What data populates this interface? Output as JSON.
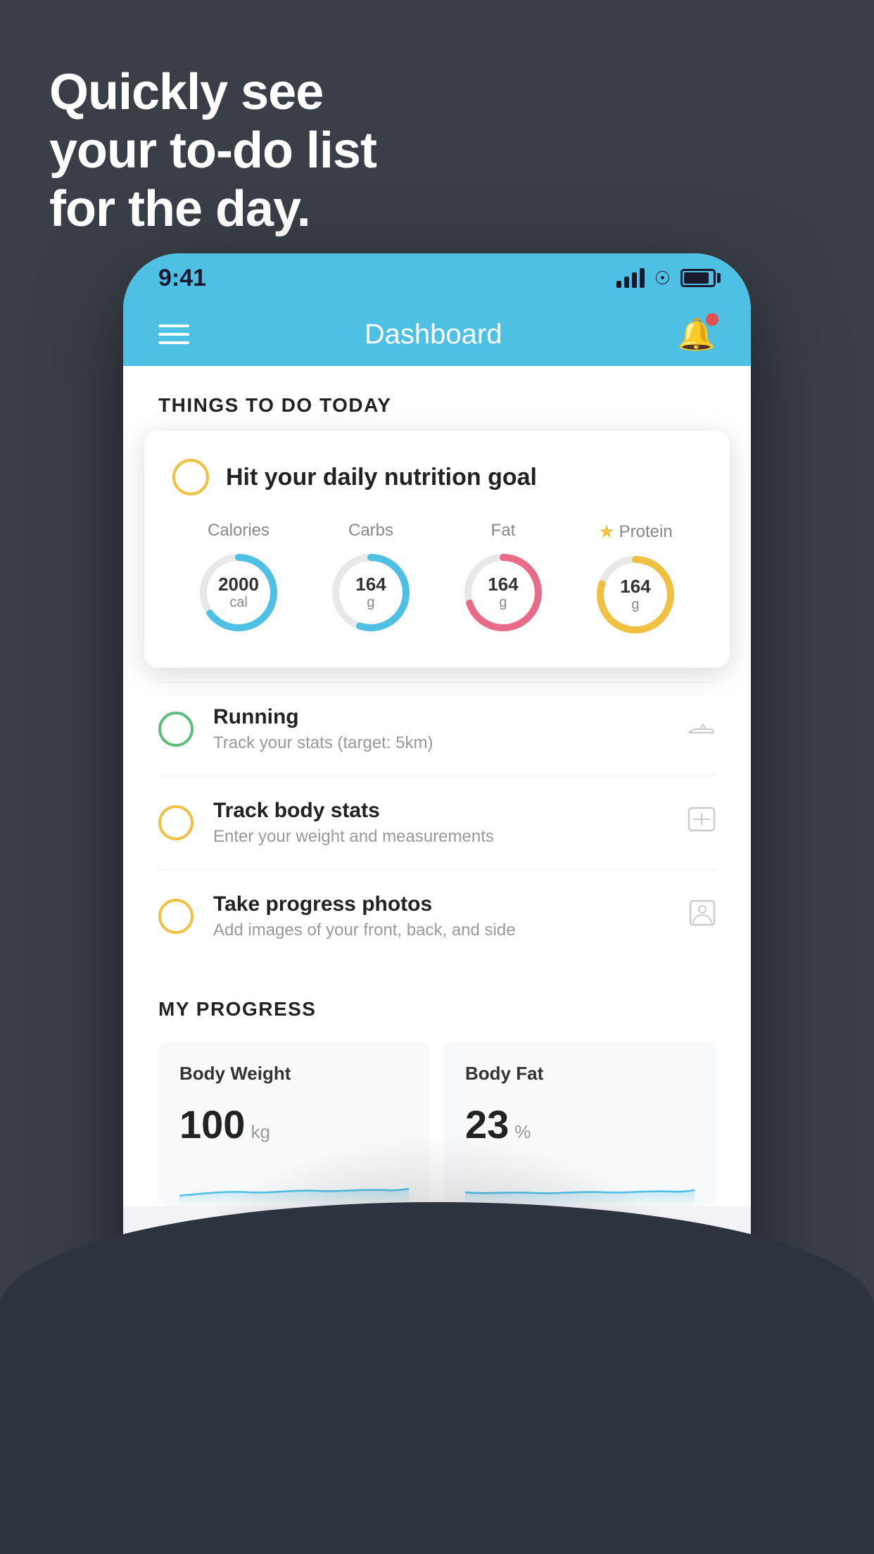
{
  "hero": {
    "line1": "Quickly see",
    "line2": "your to-do list",
    "line3": "for the day."
  },
  "statusBar": {
    "time": "9:41"
  },
  "navBar": {
    "title": "Dashboard"
  },
  "thingsToDoSection": {
    "title": "THINGS TO DO TODAY"
  },
  "nutritionCard": {
    "checkboxColor": "yellow",
    "title": "Hit your daily nutrition goal",
    "nutrients": [
      {
        "label": "Calories",
        "value": "2000",
        "unit": "cal",
        "color": "blue",
        "percent": 65,
        "starred": false
      },
      {
        "label": "Carbs",
        "value": "164",
        "unit": "g",
        "color": "blue",
        "percent": 55,
        "starred": false
      },
      {
        "label": "Fat",
        "value": "164",
        "unit": "g",
        "color": "pink",
        "percent": 70,
        "starred": false
      },
      {
        "label": "Protein",
        "value": "164",
        "unit": "g",
        "color": "yellow",
        "percent": 80,
        "starred": true
      }
    ]
  },
  "todoItems": [
    {
      "id": "running",
      "checkboxColor": "green",
      "main": "Running",
      "sub": "Track your stats (target: 5km)",
      "icon": "shoe"
    },
    {
      "id": "track-body",
      "checkboxColor": "yellow",
      "main": "Track body stats",
      "sub": "Enter your weight and measurements",
      "icon": "scale"
    },
    {
      "id": "progress-photos",
      "checkboxColor": "yellow",
      "main": "Take progress photos",
      "sub": "Add images of your front, back, and side",
      "icon": "person"
    }
  ],
  "progressSection": {
    "title": "MY PROGRESS",
    "cards": [
      {
        "title": "Body Weight",
        "value": "100",
        "unit": "kg"
      },
      {
        "title": "Body Fat",
        "value": "23",
        "unit": "%"
      }
    ]
  }
}
